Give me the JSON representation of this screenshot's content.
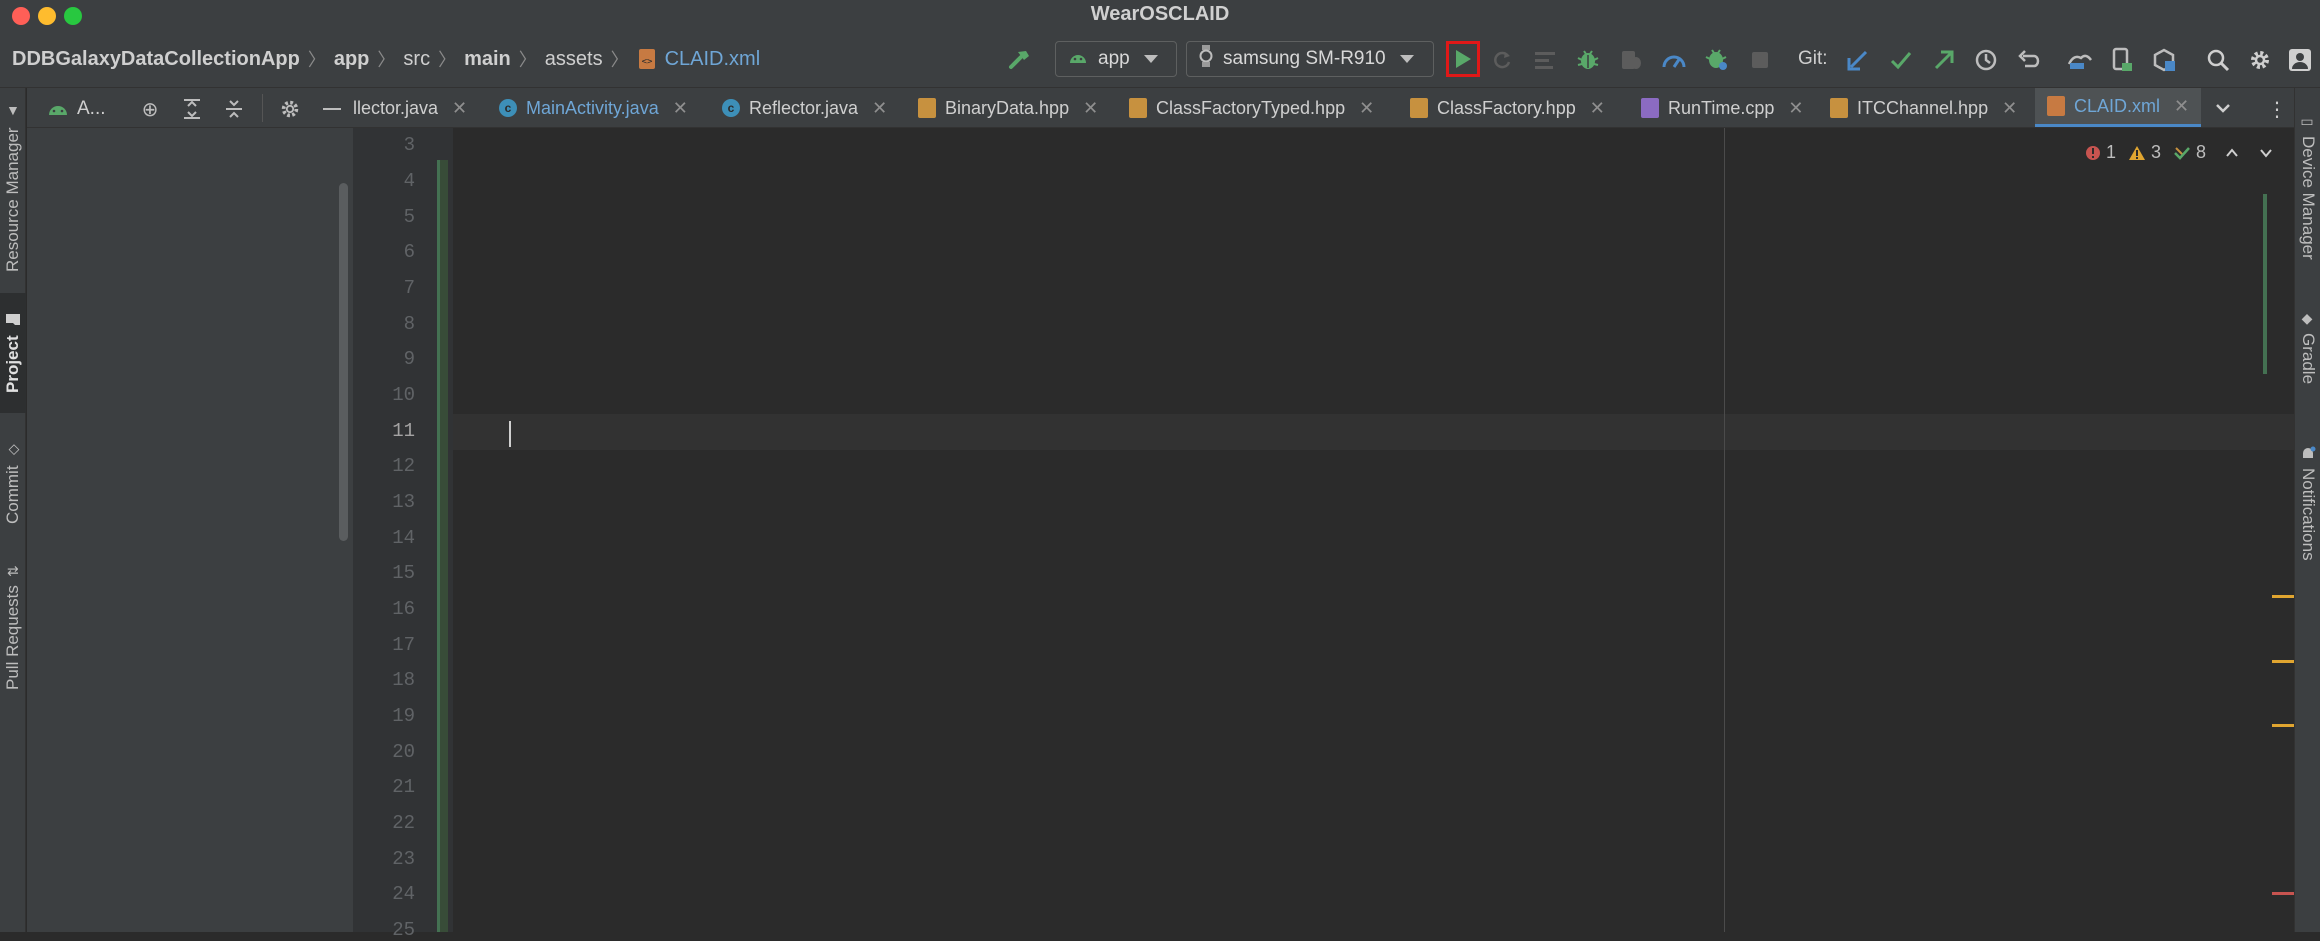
{
  "window": {
    "title": "WearOSCLAID"
  },
  "breadcrumb": [
    {
      "label": "DDBGalaxyDataCollectionApp",
      "bold": true
    },
    {
      "label": "app",
      "bold": true
    },
    {
      "label": "src",
      "bold": false
    },
    {
      "label": "main",
      "bold": true
    },
    {
      "label": "assets",
      "bold": false
    },
    {
      "label": "CLAID.xml",
      "bold": false,
      "icon": "xml-file-icon"
    }
  ],
  "toolbar": {
    "build_icon": "hammer-icon",
    "run_config": "app",
    "device": "samsung SM-R910",
    "run_icon": "run-play-icon",
    "git_label": "Git:"
  },
  "left_strip": {
    "resource_manager": "Resource Manager",
    "project": "Project",
    "commit": "Commit",
    "pull_requests": "Pull Requests"
  },
  "project_panel": {
    "title": "A..."
  },
  "tabs": [
    {
      "label": "llector.java",
      "icon": "java-file-icon",
      "active": false
    },
    {
      "label": "MainActivity.java",
      "icon": "class-icon",
      "active": false,
      "color": "#6fa6d6"
    },
    {
      "label": "Reflector.java",
      "icon": "class-icon",
      "active": false
    },
    {
      "label": "BinaryData.hpp",
      "icon": "header-file-icon",
      "active": false
    },
    {
      "label": "ClassFactoryTyped.hpp",
      "icon": "header-file-icon",
      "active": false
    },
    {
      "label": "ClassFactory.hpp",
      "icon": "header-file-icon",
      "active": false
    },
    {
      "label": "RunTime.cpp",
      "icon": "cpp-file-icon",
      "active": false
    },
    {
      "label": "ITCChannel.hpp",
      "icon": "header-file-icon",
      "active": false
    },
    {
      "label": "CLAID.xml",
      "icon": "xml-file-icon",
      "active": true,
      "color": "#6fa6d6"
    }
  ],
  "editor": {
    "line_numbers": [
      "3",
      "4",
      "5",
      "6",
      "7",
      "8",
      "9",
      "10",
      "11",
      "12",
      "13",
      "14",
      "15",
      "16",
      "17",
      "18",
      "19",
      "20",
      "21",
      "22",
      "23",
      "24",
      "25"
    ],
    "current_line": "11",
    "inspections": {
      "errors": "1",
      "warnings": "3",
      "weak_warnings": "8"
    }
  },
  "right_strip": {
    "device_manager": "Device Manager",
    "gradle": "Gradle",
    "notifications": "Notifications"
  },
  "colors": {
    "accent_blue": "#4a88c7",
    "run_green": "#59a869",
    "error_red": "#c75450",
    "warning_yellow": "#e0a530",
    "change_green": "#447152"
  }
}
